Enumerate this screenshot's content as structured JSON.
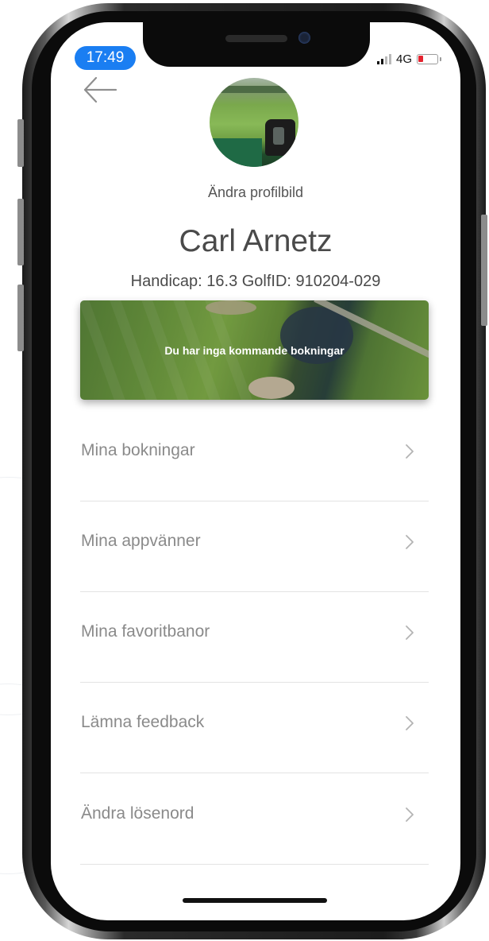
{
  "status_bar": {
    "time": "17:49",
    "network": "4G"
  },
  "profile": {
    "change_photo_label": "Ändra profilbild",
    "name": "Carl Arnetz",
    "meta": "Handicap: 16.3 GolfID: 910204-029"
  },
  "booking_banner": {
    "text": "Du har inga kommande bokningar"
  },
  "menu": {
    "items": [
      {
        "label": "Mina bokningar"
      },
      {
        "label": "Mina appvänner"
      },
      {
        "label": "Mina favoritbanor"
      },
      {
        "label": "Lämna feedback"
      },
      {
        "label": "Ändra lösenord"
      }
    ]
  },
  "icons": [
    "back-arrow-icon",
    "chevron-right-icon",
    "signal-icon",
    "battery-icon"
  ],
  "colors": {
    "time_pill": "#1a7ef2",
    "battery_low": "#e5232f",
    "menu_text": "#8a8a8a",
    "divider": "#e3e3e3"
  }
}
